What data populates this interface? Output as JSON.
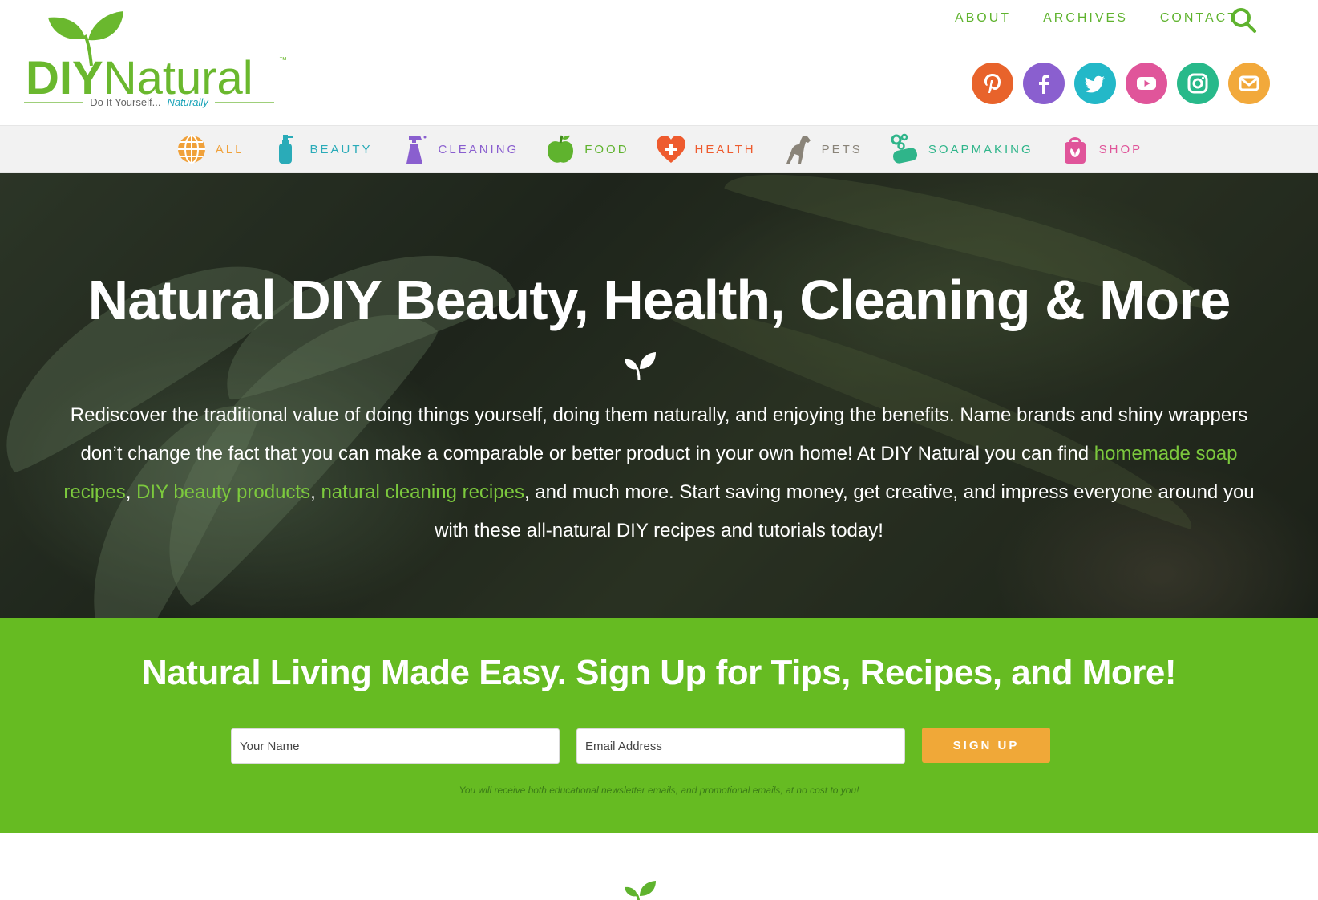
{
  "logo": {
    "diy": "DIY",
    "natural": "Natural",
    "tm": "™",
    "tagline_prefix": "Do It Yourself...",
    "tagline_emphasis": "Naturally"
  },
  "topnav": {
    "about": "ABOUT",
    "archives": "ARCHIVES",
    "contact": "CONTACT"
  },
  "social": [
    {
      "icon": "pinterest-icon",
      "color": "#e8632b"
    },
    {
      "icon": "facebook-icon",
      "color": "#8a5fcf"
    },
    {
      "icon": "twitter-icon",
      "color": "#23b8c8"
    },
    {
      "icon": "youtube-icon",
      "color": "#e0559a"
    },
    {
      "icon": "instagram-icon",
      "color": "#28b98a"
    },
    {
      "icon": "email-icon",
      "color": "#f2a93b"
    }
  ],
  "categories": [
    {
      "label": "ALL",
      "color": "#f0a13a",
      "icon": "globe-icon"
    },
    {
      "label": "BEAUTY",
      "color": "#2aabb8",
      "icon": "lotion-bottle-icon"
    },
    {
      "label": "CLEANING",
      "color": "#8a5fcf",
      "icon": "spray-bottle-icon"
    },
    {
      "label": "FOOD",
      "color": "#5fb32e",
      "icon": "apple-icon"
    },
    {
      "label": "HEALTH",
      "color": "#ee5b2e",
      "icon": "heart-plus-icon"
    },
    {
      "label": "PETS",
      "color": "#8a8479",
      "icon": "dog-icon"
    },
    {
      "label": "SOAPMAKING",
      "color": "#2fb58a",
      "icon": "soap-icon"
    },
    {
      "label": "SHOP",
      "color": "#e0559a",
      "icon": "shopping-bag-icon"
    }
  ],
  "hero": {
    "title": "Natural DIY Beauty, Health, Cleaning & More",
    "text_1": "Rediscover the traditional value of doing things yourself, doing them naturally, and enjoying the benefits. Name brands and shiny wrappers don’t change the fact that you can make a comparable or better product in your own home! At DIY Natural you can find ",
    "link_1": "homemade soap recipes",
    "sep_1": ", ",
    "link_2": "DIY beauty products",
    "sep_2": ", ",
    "link_3": "natural cleaning recipes",
    "text_2": ", and much more. Start saving money, get creative, and impress everyone around you with these all-natural DIY recipes and tutorials today!"
  },
  "signup": {
    "title": "Natural Living Made Easy. Sign Up for Tips, Recipes, and More!",
    "name_placeholder": "Your Name",
    "email_placeholder": "Email Address",
    "button": "SIGN UP",
    "note": "You will receive both educational newsletter emails, and promotional emails, at no cost to you!"
  },
  "colors": {
    "brand_green": "#66bb22",
    "accent_orange": "#f0a838"
  }
}
